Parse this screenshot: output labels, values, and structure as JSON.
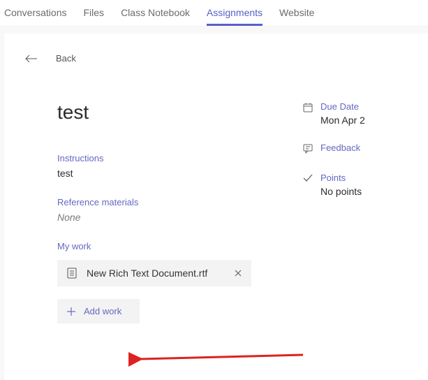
{
  "tabs": {
    "conversations": "Conversations",
    "files": "Files",
    "notebook": "Class Notebook",
    "assignments": "Assignments",
    "website": "Website"
  },
  "back": {
    "label": "Back"
  },
  "assignment": {
    "title": "test",
    "instructions_label": "Instructions",
    "instructions_text": "test",
    "reference_label": "Reference materials",
    "reference_text": "None",
    "mywork_label": "My work",
    "workfile": "New Rich Text Document.rtf",
    "addwork_label": "Add work"
  },
  "side": {
    "due_label": "Due Date",
    "due_value": "Mon Apr 2",
    "feedback_label": "Feedback",
    "points_label": "Points",
    "points_value": "No points"
  }
}
